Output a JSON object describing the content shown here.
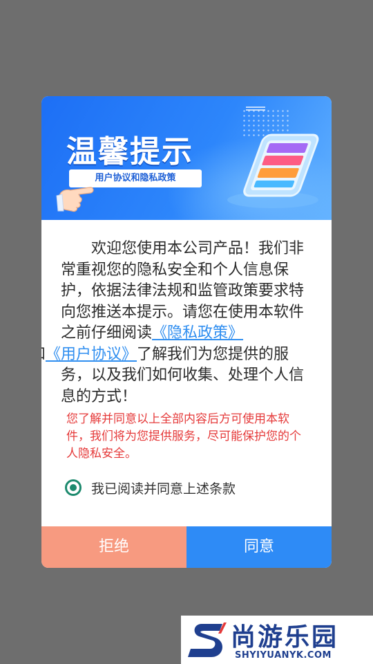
{
  "banner": {
    "title": "温馨提示",
    "subtitle": "用户协议和隐私政策"
  },
  "content": {
    "intro": "欢迎您使用本公司产品！我们非常重视您的隐私安全和个人信息保护，依据法律法规和监管政策要求特向您推送本提示。请您在使用本软件之前仔细阅读",
    "privacy_link": "《隐私政策》",
    "conjunction": "和",
    "terms_link": "《用户协议》",
    "outro": "了解我们为您提供的服务，以及我们如何收集、处理个人信息的方式！",
    "notice": "您了解并同意以上全部内容后方可使用本软件，我们将为您提供服务，尽可能保护您的个人隐私安全。",
    "agree_checkbox_label": "我已阅读并同意上述条款",
    "agree_checked": true
  },
  "buttons": {
    "refuse": "拒绝",
    "agree": "同意"
  },
  "watermark": {
    "name": "尚游乐园",
    "url": "SHYIYUANYK.COM"
  },
  "colors": {
    "backdrop": "#6e6e6e",
    "banner": "#2d86fb",
    "link": "#2f8ef0",
    "notice": "#e53a3a",
    "radio": "#1d8a6e",
    "refuse_button": "#f79a80",
    "agree_button": "#2e8bf6"
  },
  "icons": [
    "pointing-hand-icon",
    "smartphone-illustration-icon",
    "radio-checked-icon",
    "site-logo-icon"
  ]
}
